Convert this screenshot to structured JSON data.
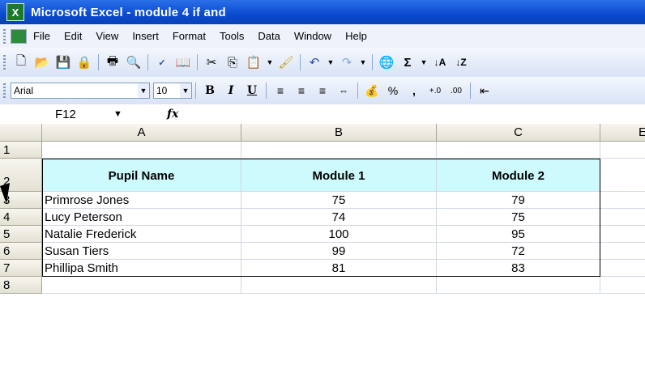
{
  "window": {
    "title": "Microsoft Excel - module 4 if and"
  },
  "menu": [
    {
      "label": "File"
    },
    {
      "label": "Edit"
    },
    {
      "label": "View"
    },
    {
      "label": "Insert"
    },
    {
      "label": "Format"
    },
    {
      "label": "Tools"
    },
    {
      "label": "Data"
    },
    {
      "label": "Window"
    },
    {
      "label": "Help"
    }
  ],
  "format_bar": {
    "font": "Arial",
    "size": "10"
  },
  "formula_bar": {
    "name_box": "F12",
    "fx": "fx",
    "content": ""
  },
  "columns": [
    "A",
    "B",
    "C",
    "E"
  ],
  "row_numbers": [
    "1",
    "2",
    "3",
    "4",
    "5",
    "6",
    "7",
    "8"
  ],
  "table": {
    "headers": [
      "Pupil Name",
      "Module 1",
      "Module 2"
    ],
    "rows": [
      [
        "Primrose Jones",
        "75",
        "79"
      ],
      [
        "Lucy Peterson",
        "74",
        "75"
      ],
      [
        "Natalie Frederick",
        "100",
        "95"
      ],
      [
        "Susan Tiers",
        "99",
        "72"
      ],
      [
        "Phillipa Smith",
        "81",
        "83"
      ]
    ]
  }
}
